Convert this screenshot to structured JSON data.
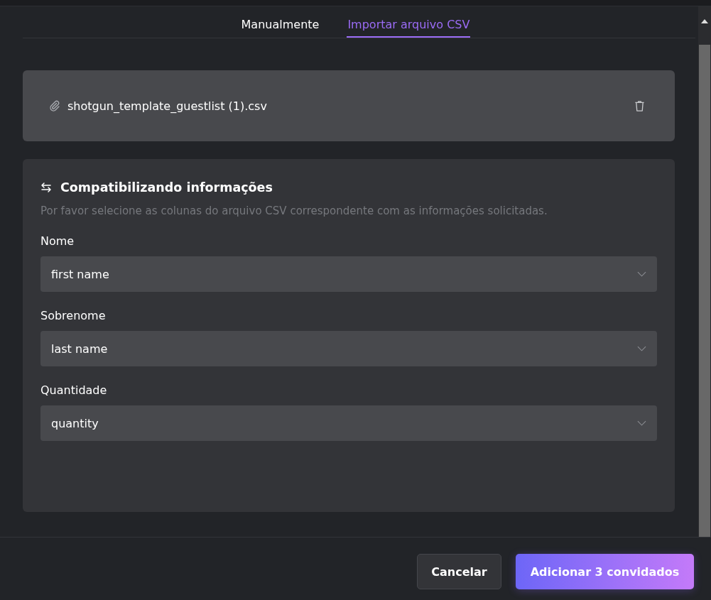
{
  "tabs": [
    {
      "label": "Manualmente",
      "selected": false
    },
    {
      "label": "Importar arquivo CSV",
      "selected": true
    }
  ],
  "file": {
    "name": "shotgun_template_guestlist (1).csv"
  },
  "mapping": {
    "title": "Compatibilizando informações",
    "description": "Por favor selecione as colunas do arquivo CSV correspondente com as informações solicitadas.",
    "fields": [
      {
        "label": "Nome",
        "value": "first name"
      },
      {
        "label": "Sobrenome",
        "value": "last name"
      },
      {
        "label": "Quantidade",
        "value": "quantity"
      }
    ]
  },
  "buttons": [
    {
      "label": "Cancelar",
      "kind": "secondary"
    },
    {
      "label": "Adicionar 3 convidados",
      "kind": "primary"
    }
  ]
}
